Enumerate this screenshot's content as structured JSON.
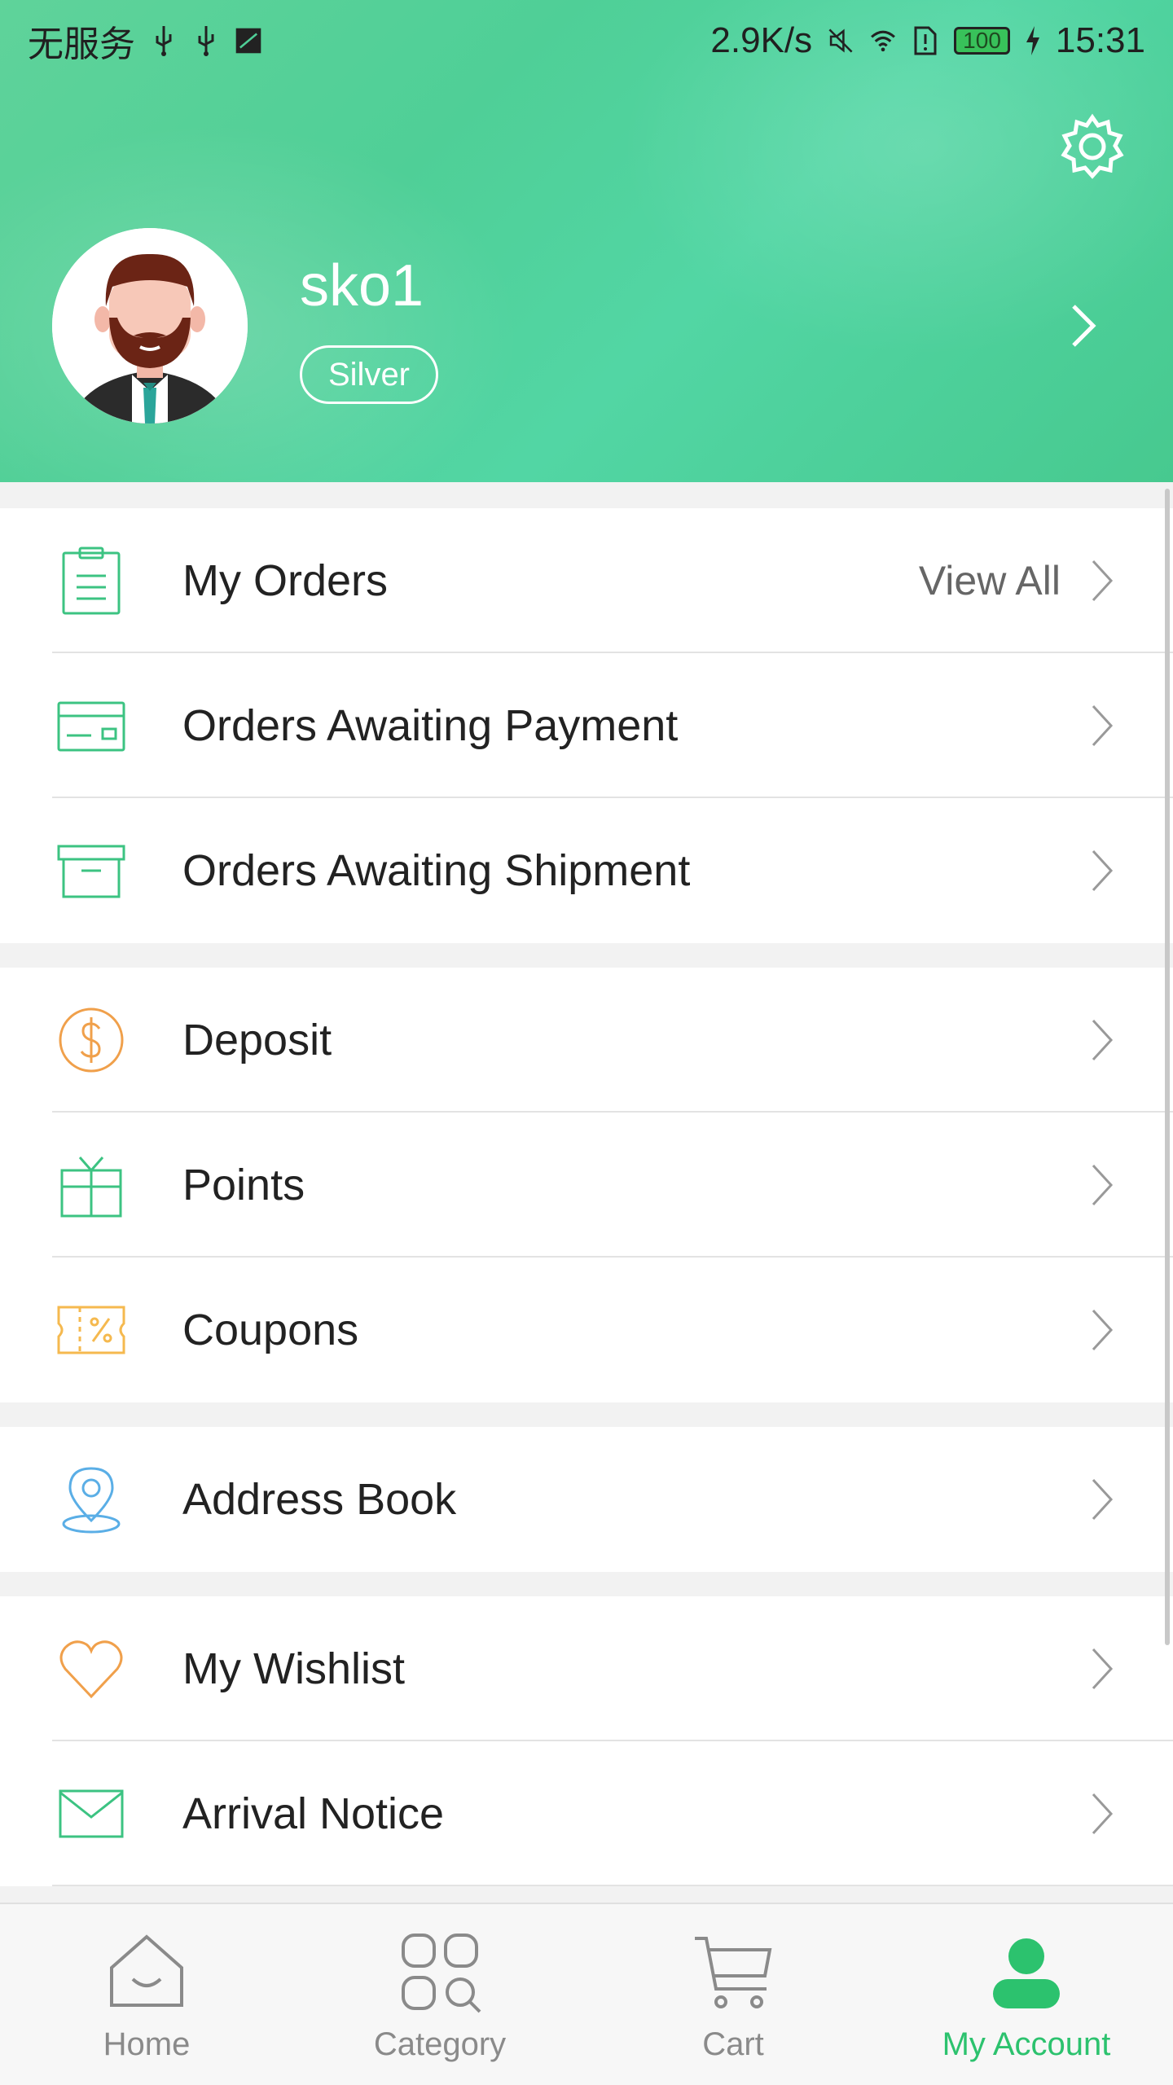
{
  "status_bar": {
    "carrier": "无服务",
    "speed": "2.9K/s",
    "battery": "100",
    "time": "15:31"
  },
  "profile": {
    "username": "sko1",
    "level": "Silver"
  },
  "orders": {
    "title": "My Orders",
    "view_all": "View All",
    "items": [
      {
        "label": "Orders Awaiting Payment"
      },
      {
        "label": "Orders Awaiting Shipment"
      }
    ]
  },
  "finance": {
    "items": [
      {
        "label": "Deposit"
      },
      {
        "label": "Points"
      },
      {
        "label": "Coupons"
      }
    ]
  },
  "address": {
    "label": "Address Book"
  },
  "misc": {
    "items": [
      {
        "label": "My Wishlist"
      },
      {
        "label": "Arrival Notice"
      }
    ]
  },
  "bottom_nav": {
    "items": [
      {
        "label": "Home",
        "active": false
      },
      {
        "label": "Category",
        "active": false
      },
      {
        "label": "Cart",
        "active": false
      },
      {
        "label": "My Account",
        "active": true
      }
    ]
  },
  "colors": {
    "brand_green": "#2cc26e",
    "orange": "#f0a04b",
    "icon_green": "#3cc382",
    "icon_blue": "#5aaee6",
    "header_green": "#52d49c"
  }
}
